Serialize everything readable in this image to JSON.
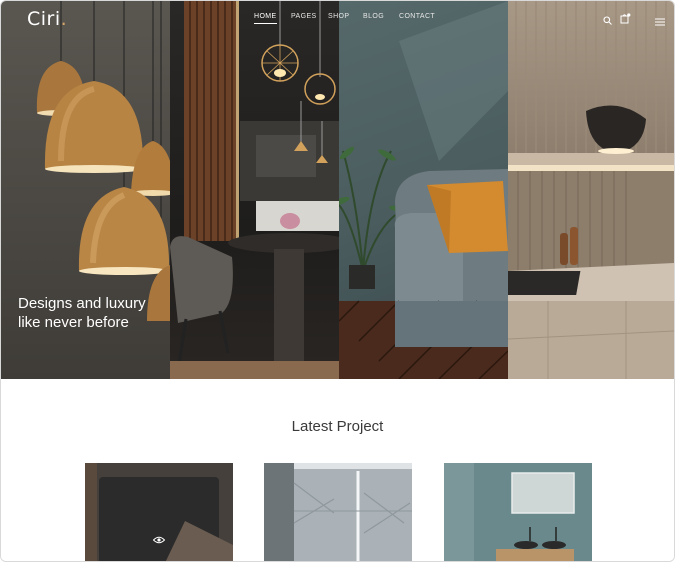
{
  "brand": {
    "name": "Ciri",
    "accent": "#d6a66b"
  },
  "nav": {
    "items": [
      {
        "label": "HOME",
        "active": true
      },
      {
        "label": "PAGES",
        "active": false
      },
      {
        "label": "SHOP",
        "active": false
      },
      {
        "label": "BLOG",
        "active": false
      },
      {
        "label": "CONTACT",
        "active": false
      }
    ],
    "icons": [
      "search-icon",
      "cart-icon",
      "menu-icon"
    ]
  },
  "hero": {
    "headline": "Designs and luxury like never before"
  },
  "projects": {
    "title": "Latest Project",
    "items": [
      {
        "name": "project-1",
        "icon": "eye-icon"
      },
      {
        "name": "project-2"
      },
      {
        "name": "project-3"
      }
    ]
  }
}
